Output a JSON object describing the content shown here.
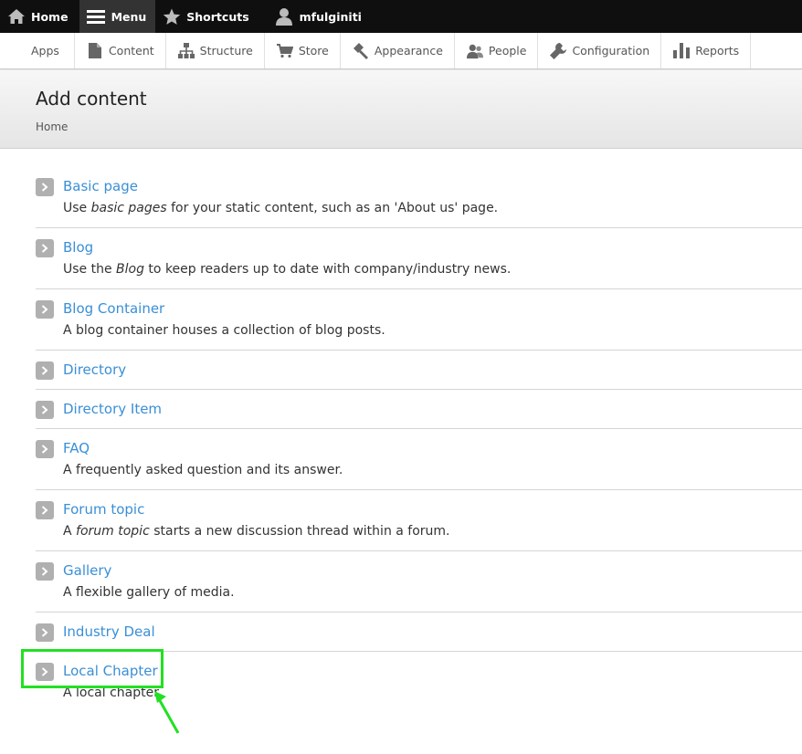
{
  "toolbar": {
    "items": [
      {
        "label": "Home",
        "icon": "home-icon"
      },
      {
        "label": "Menu",
        "icon": "hamburger-icon",
        "active": true
      },
      {
        "label": "Shortcuts",
        "icon": "star-icon"
      },
      {
        "label": "mfulginiti",
        "icon": "user-icon"
      }
    ]
  },
  "tray": {
    "items": [
      {
        "label": "Apps"
      },
      {
        "label": "Content",
        "icon": "file-icon"
      },
      {
        "label": "Structure",
        "icon": "sitemap-icon"
      },
      {
        "label": "Store",
        "icon": "cart-icon"
      },
      {
        "label": "Appearance",
        "icon": "paint-icon"
      },
      {
        "label": "People",
        "icon": "people-icon"
      },
      {
        "label": "Configuration",
        "icon": "wrench-icon"
      },
      {
        "label": "Reports",
        "icon": "bar-chart-icon"
      }
    ]
  },
  "header": {
    "title": "Add content",
    "breadcrumb": "Home"
  },
  "content_types": [
    {
      "title": "Basic page",
      "desc_pre": "Use ",
      "desc_em": "basic pages",
      "desc_post": " for your static content, such as an 'About us' page."
    },
    {
      "title": "Blog",
      "desc_pre": "Use the ",
      "desc_em": "Blog",
      "desc_post": " to keep readers up to date with company/industry news."
    },
    {
      "title": "Blog Container",
      "desc_pre": "A blog container houses a collection of blog posts.",
      "desc_em": "",
      "desc_post": ""
    },
    {
      "title": "Directory",
      "desc_pre": "",
      "desc_em": "",
      "desc_post": ""
    },
    {
      "title": "Directory Item",
      "desc_pre": "",
      "desc_em": "",
      "desc_post": ""
    },
    {
      "title": "FAQ",
      "desc_pre": "A frequently asked question and its answer.",
      "desc_em": "",
      "desc_post": ""
    },
    {
      "title": "Forum topic",
      "desc_pre": "A ",
      "desc_em": "forum topic",
      "desc_post": " starts a new discussion thread within a forum."
    },
    {
      "title": "Gallery",
      "desc_pre": "A flexible gallery of media.",
      "desc_em": "",
      "desc_post": ""
    },
    {
      "title": "Industry Deal",
      "desc_pre": "",
      "desc_em": "",
      "desc_post": ""
    },
    {
      "title": "Local Chapter",
      "desc_pre": "A local chapter.",
      "desc_em": "",
      "desc_post": ""
    }
  ],
  "colors": {
    "link": "#3a8fd6",
    "toolbar_bg": "#0f0f0f",
    "highlight": "#22e022"
  }
}
